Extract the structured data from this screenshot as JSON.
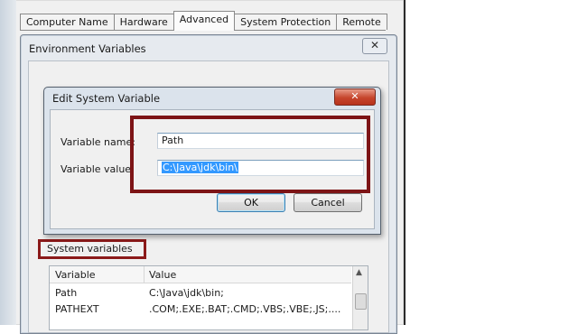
{
  "system_properties": {
    "tabs": [
      "Computer Name",
      "Hardware",
      "Advanced",
      "System Protection",
      "Remote"
    ],
    "active_tab": "Advanced"
  },
  "env_window": {
    "title": "Environment Variables",
    "close_glyph": "✕"
  },
  "system_variables": {
    "label": "System variables",
    "columns": [
      "Variable",
      "Value"
    ],
    "rows": [
      {
        "variable": "Path",
        "value": "C:\\Java\\jdk\\bin;"
      },
      {
        "variable": "PATHEXT",
        "value": ".COM;.EXE;.BAT;.CMD;.VBS;.VBE;.JS;...."
      }
    ]
  },
  "edit_dialog": {
    "title": "Edit System Variable",
    "close_glyph": "✕",
    "name_label": "Variable name:",
    "name_value": "Path",
    "value_label": "Variable value:",
    "value_value": "C:\\Java\\jdk\\bin\\",
    "ok_label": "OK",
    "cancel_label": "Cancel"
  },
  "colors": {
    "highlight_border": "#7d1416",
    "selection": "#3399ff",
    "close_button": "#c6452c"
  }
}
